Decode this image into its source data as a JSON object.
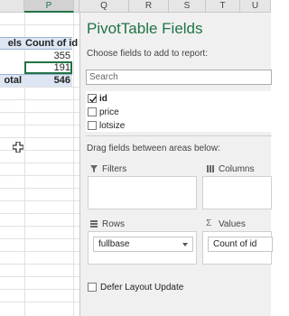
{
  "spreadsheet": {
    "columns": [
      "P",
      "Q",
      "R",
      "S",
      "T",
      "U"
    ],
    "selected_column": "P",
    "row_labels_header": "els",
    "count_header": "Count of id",
    "values": [
      "355",
      "191"
    ],
    "total_label": "otal",
    "total_value": "546"
  },
  "pivot_pane": {
    "title": "PivotTable Fields",
    "subtitle": "Choose fields to add to report:",
    "search_placeholder": "Search",
    "fields": [
      {
        "label": "id",
        "checked": true
      },
      {
        "label": "price",
        "checked": false
      },
      {
        "label": "lotsize",
        "checked": false
      }
    ],
    "drag_hint": "Drag fields between areas below:",
    "areas": {
      "filters": {
        "label": "Filters",
        "icon": "filter-icon"
      },
      "columns": {
        "label": "Columns",
        "icon": "columns-icon"
      },
      "rows": {
        "label": "Rows",
        "icon": "rows-icon",
        "item": "fullbase"
      },
      "values": {
        "label": "Values",
        "icon": "sigma-icon",
        "item": "Count of id"
      }
    },
    "defer_label": "Defer Layout Update"
  },
  "colors": {
    "accent": "#217346",
    "header_band": "#dde6f2"
  }
}
